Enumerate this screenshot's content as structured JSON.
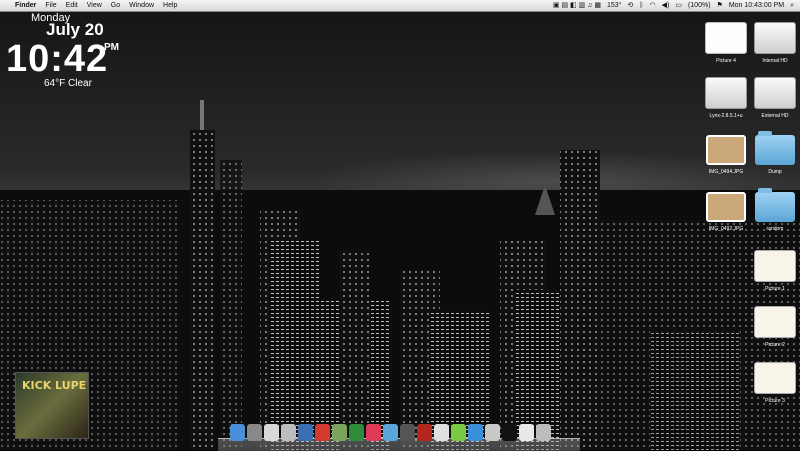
{
  "menubar": {
    "apple_icon": "apple-icon",
    "app_name": "Finder",
    "menus": [
      "File",
      "Edit",
      "View",
      "Go",
      "Window",
      "Help"
    ],
    "status": {
      "battery_pct": "(100%)",
      "temp": "153°",
      "clock": "Mon 10:43:00 PM"
    }
  },
  "clock_widget": {
    "day": "Monday",
    "date": "July 20",
    "time": "10:42",
    "ampm": "PM",
    "weather": "64°F Clear"
  },
  "desktop_icons": [
    {
      "label": "Picture 4"
    },
    {
      "label": "Internal HD"
    },
    {
      "label": "Lynx-2.8.5.1+u"
    },
    {
      "label": "External HD"
    },
    {
      "label": "IMG_0494.JPG"
    },
    {
      "label": "Dump"
    },
    {
      "label": "IMG_0492.JPG"
    },
    {
      "label": "random"
    },
    {
      "label": "Picture 1"
    },
    {
      "label": "Picture 2"
    },
    {
      "label": "Picture 3"
    }
  ],
  "album_art": {
    "text": "KICK LUPE"
  },
  "dock": {
    "items": [
      {
        "name": "finder-icon",
        "color": "#4a8fd8"
      },
      {
        "name": "system-preferences-icon",
        "color": "#888888"
      },
      {
        "name": "terminal-like-icon",
        "color": "#d8d8d8"
      },
      {
        "name": "alien-icon",
        "color": "#bdbdbd"
      },
      {
        "name": "book-icon",
        "color": "#3b6fb1"
      },
      {
        "name": "calendar-icon",
        "color": "#d33a2f"
      },
      {
        "name": "photo-icon",
        "color": "#7aa35b"
      },
      {
        "name": "green-icon",
        "color": "#2e8b3a"
      },
      {
        "name": "heart-icon",
        "color": "#e03a5a"
      },
      {
        "name": "fish-icon",
        "color": "#59a7d8"
      },
      {
        "name": "gamepad-icon",
        "color": "#555555"
      },
      {
        "name": "red-icon",
        "color": "#b3261e"
      },
      {
        "name": "ball-icon",
        "color": "#e0e0e0"
      },
      {
        "name": "green-circle-icon",
        "color": "#7ac943"
      },
      {
        "name": "itunes-icon",
        "color": "#3a8fd9"
      },
      {
        "name": "mail-icon",
        "color": "#c9c9c9"
      },
      {
        "name": "console-icon",
        "color": "#111111"
      },
      {
        "name": "documents-icon",
        "color": "#e9e9e9"
      },
      {
        "name": "trash-icon",
        "color": "#bcbcbc"
      }
    ]
  }
}
